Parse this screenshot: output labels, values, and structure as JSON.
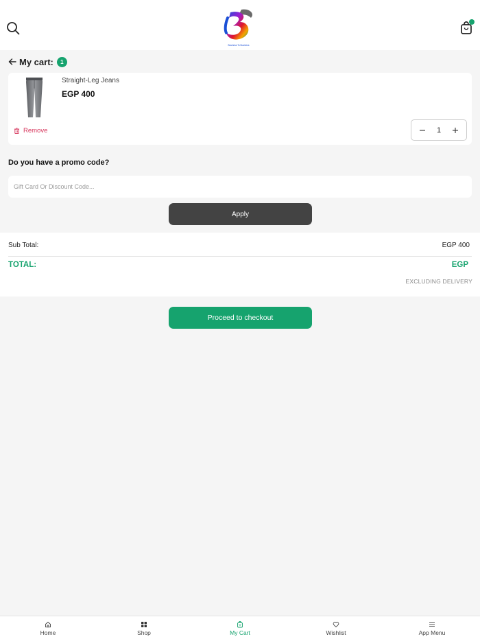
{
  "header": {
    "logo_text": "Business To Business",
    "cart_badge_color": "#16a36e"
  },
  "cart": {
    "title": "My cart:",
    "count": "1",
    "items": [
      {
        "name": "Straight-Leg Jeans",
        "price": "EGP 400",
        "remove_label": "Remove",
        "quantity": "1"
      }
    ]
  },
  "promo": {
    "question": "Do you have a promo code?",
    "placeholder": "Gift Card Or Discount Code...",
    "apply_label": "Apply"
  },
  "totals": {
    "subtotal_label": "Sub Total:",
    "subtotal_value": "EGP 400",
    "total_label": "TOTAL:",
    "total_value": "EGP",
    "excluding_note": "EXCLUDING DELIVERY"
  },
  "checkout": {
    "label": "Proceed to checkout"
  },
  "nav": {
    "items": [
      {
        "label": "Home",
        "icon": "home-icon"
      },
      {
        "label": "Shop",
        "icon": "grid-icon"
      },
      {
        "label": "My Cart",
        "icon": "bag-icon",
        "active": true
      },
      {
        "label": "Wishlist",
        "icon": "heart-icon"
      },
      {
        "label": "App Menu",
        "icon": "menu-icon"
      }
    ]
  },
  "colors": {
    "accent": "#16a36e",
    "remove": "#d6335a",
    "apply_button": "#434343",
    "background": "#f5f5f5"
  }
}
